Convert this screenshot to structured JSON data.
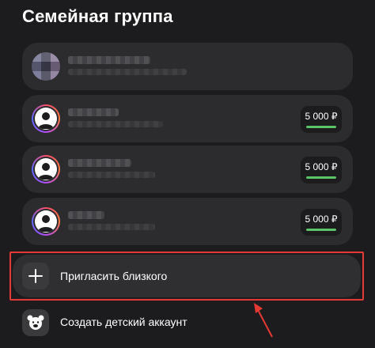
{
  "page": {
    "title": "Семейная группа"
  },
  "owner": {
    "name_masked": true
  },
  "members": [
    {
      "limit": "5 000 ₽",
      "limit_fill": 1.0
    },
    {
      "limit": "5 000 ₽",
      "limit_fill": 1.0
    },
    {
      "limit": "5 000 ₽",
      "limit_fill": 1.0
    }
  ],
  "actions": {
    "invite_label": "Пригласить близкого",
    "child_account_label": "Создать детский аккаунт"
  },
  "icons": {
    "invite": "plus-icon",
    "child": "bear-icon",
    "member": "user-avatar-icon"
  },
  "colors": {
    "background": "#1c1c1e",
    "card": "#2c2c2e",
    "limit_bar": "#5ac46a",
    "highlight": "#e53935"
  }
}
